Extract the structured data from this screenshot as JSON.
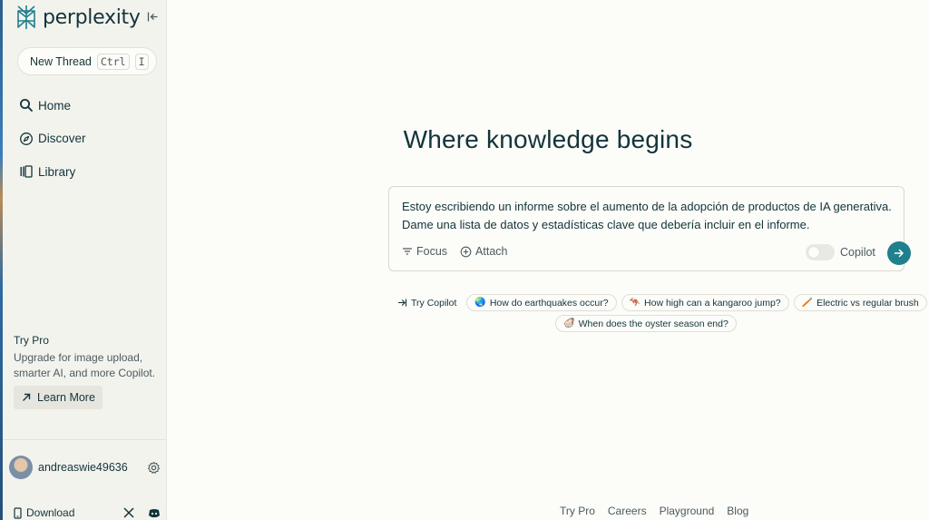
{
  "app": {
    "name": "perplexity"
  },
  "sidebar": {
    "new_thread_label": "New Thread",
    "shortcut_key1": "Ctrl",
    "shortcut_key2": "I",
    "nav": [
      {
        "label": "Home",
        "icon": "search-icon"
      },
      {
        "label": "Discover",
        "icon": "compass-icon"
      },
      {
        "label": "Library",
        "icon": "library-icon"
      }
    ],
    "try_pro": {
      "title": "Try Pro",
      "description": "Upgrade for image upload, smarter AI, and more Copilot.",
      "learn_more_label": "Learn More"
    },
    "user": {
      "username": "andreaswie49636"
    },
    "download_label": "Download"
  },
  "main": {
    "headline": "Where knowledge begins",
    "query_text": "Estoy escribiendo un informe sobre el aumento de la adopción de productos de IA generativa. Dame una lista de datos y estadísticas clave que debería incluir en el informe.",
    "focus_label": "Focus",
    "attach_label": "Attach",
    "copilot_label": "Copilot",
    "suggestions": {
      "try_copilot": "Try Copilot",
      "items": [
        {
          "label": "How do earthquakes occur?",
          "emoji": "🌏"
        },
        {
          "label": "How high can a kangaroo jump?",
          "emoji": "🦘"
        },
        {
          "label": "Electric vs regular brush",
          "emoji": "🪥"
        },
        {
          "label": "When does the oyster season end?",
          "emoji": "🦪"
        }
      ]
    }
  },
  "footer": {
    "links": [
      "Try Pro",
      "Careers",
      "Playground",
      "Blog"
    ]
  },
  "colors": {
    "accent": "#20808d",
    "text": "#13343b",
    "background": "#fcfcf9",
    "sidebar": "#f3f3ee"
  }
}
